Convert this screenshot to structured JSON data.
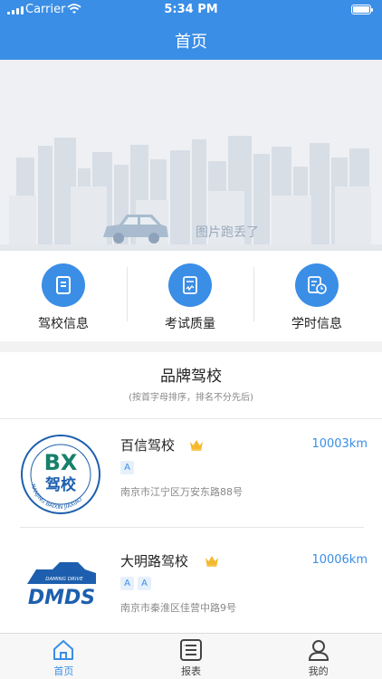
{
  "status": {
    "carrier": "Carrier",
    "time": "5:34 PM"
  },
  "nav": {
    "title": "首页"
  },
  "banner": {
    "placeholder_text": "图片跑丢了"
  },
  "quick_menu": [
    {
      "label": "驾校信息",
      "icon": "document-icon"
    },
    {
      "label": "考试质量",
      "icon": "score-sheet-icon"
    },
    {
      "label": "学时信息",
      "icon": "study-hours-icon"
    }
  ],
  "brand": {
    "title": "品牌驾校",
    "subtitle": "(按首字母排序，排名不分先后)",
    "schools": [
      {
        "name": "百信驾校",
        "distance": "10003km",
        "tags": [
          "A"
        ],
        "address": "南京市江宁区万安东路88号",
        "logo_text": "BX",
        "logo_sub": "驾校",
        "logo_ring": "NANJING BAIXIN JIAXIAO"
      },
      {
        "name": "大明路驾校",
        "distance": "10006km",
        "tags": [
          "A",
          "A"
        ],
        "address": "南京市秦淮区佳营中路9号",
        "logo_text": "DMDS",
        "logo_sub": "DAMING DRIVE"
      }
    ]
  },
  "tabbar": [
    {
      "label": "首页",
      "icon": "home-icon",
      "active": true
    },
    {
      "label": "报表",
      "icon": "report-icon",
      "active": false
    },
    {
      "label": "我的",
      "icon": "profile-icon",
      "active": false
    }
  ],
  "colors": {
    "primary": "#3a8ee6",
    "crown": "#f5b92e",
    "logo_green": "#17806a",
    "logo_blue": "#1d5fae"
  }
}
